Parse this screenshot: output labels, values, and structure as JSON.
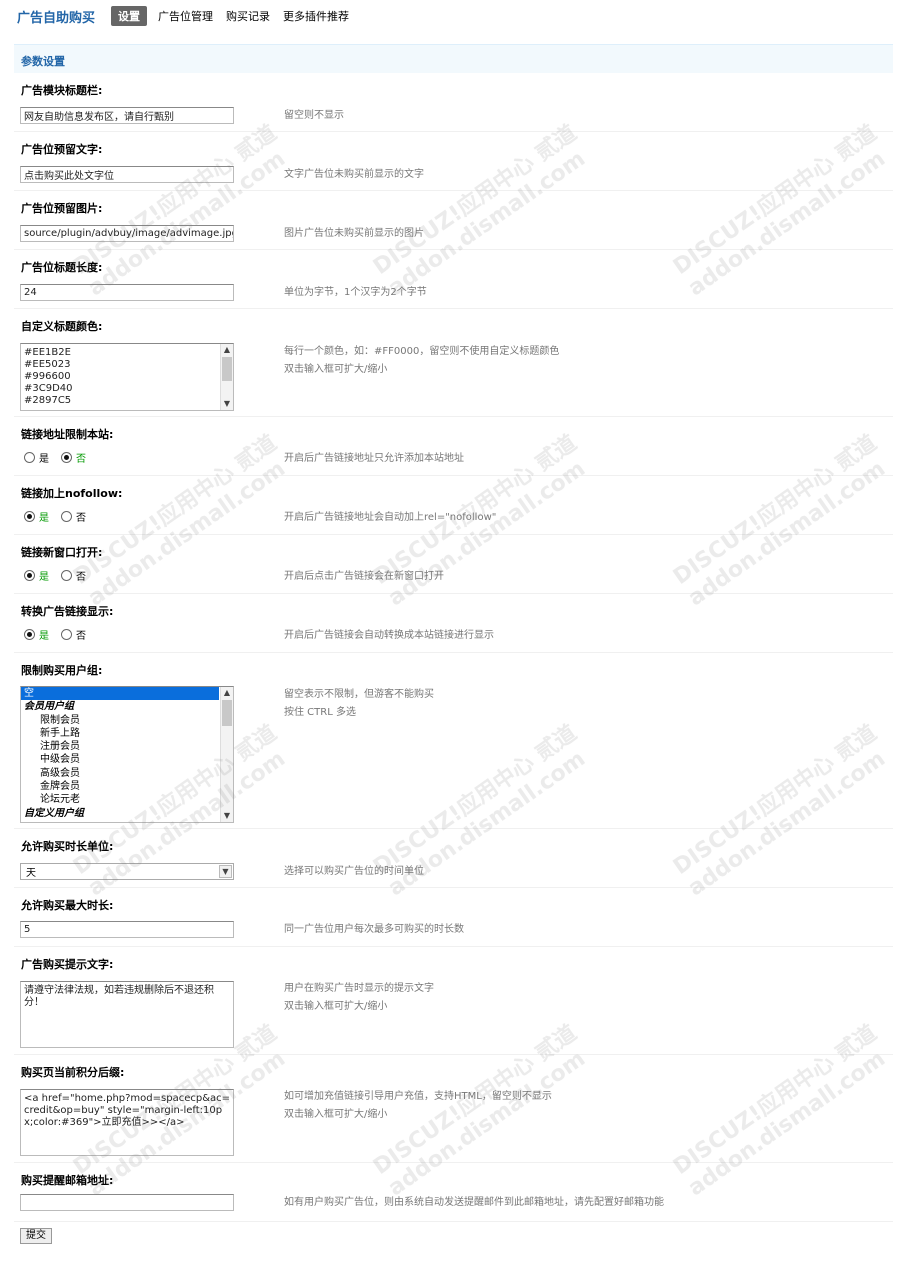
{
  "header": {
    "app_title": "广告自助购买",
    "tabs": [
      {
        "label": "设置",
        "active": true
      },
      {
        "label": "广告位管理",
        "active": false
      },
      {
        "label": "购买记录",
        "active": false
      },
      {
        "label": "更多插件推荐",
        "active": false
      }
    ]
  },
  "section": {
    "title": "参数设置"
  },
  "fields": {
    "module_title": {
      "label": "广告模块标题栏:",
      "value": "网友自助信息发布区，请自行甄别",
      "tip": "留空则不显示"
    },
    "reserved_text": {
      "label": "广告位预留文字:",
      "value": "点击购买此处文字位",
      "tip": "文字广告位未购买前显示的文字"
    },
    "reserved_image": {
      "label": "广告位预留图片:",
      "value": "source/plugin/advbuy/image/advimage.jpg",
      "tip": "图片广告位未购买前显示的图片"
    },
    "title_length": {
      "label": "广告位标题长度:",
      "value": "24",
      "tip": "单位为字节，1个汉字为2个字节"
    },
    "title_colors": {
      "label": "自定义标题颜色:",
      "lines": [
        "#EE1B2E",
        "#EE5023",
        "#996600",
        "#3C9D40",
        "#2897C5"
      ],
      "tip1": "每行一个颜色，如：#FF0000，留空则不使用自定义标题颜色",
      "tip2": "双击输入框可扩大/缩小"
    },
    "link_local": {
      "label": "链接地址限制本站:",
      "yes": "是",
      "no": "否",
      "selected": "no",
      "tip": "开启后广告链接地址只允许添加本站地址"
    },
    "nofollow": {
      "label": "链接加上nofollow:",
      "yes": "是",
      "no": "否",
      "selected": "yes",
      "tip": "开启后广告链接地址会自动加上rel=\"nofollow\""
    },
    "new_window": {
      "label": "链接新窗口打开:",
      "yes": "是",
      "no": "否",
      "selected": "yes",
      "tip": "开启后点击广告链接会在新窗口打开"
    },
    "convert_link": {
      "label": "转换广告链接显示:",
      "yes": "是",
      "no": "否",
      "selected": "yes",
      "tip": "开启后广告链接会自动转换成本站链接进行显示"
    },
    "user_groups": {
      "label": "限制购买用户组:",
      "options": [
        {
          "text": "空",
          "type": "selected"
        },
        {
          "text": "会员用户组",
          "type": "group"
        },
        {
          "text": "限制会员",
          "type": "child"
        },
        {
          "text": "新手上路",
          "type": "child"
        },
        {
          "text": "注册会员",
          "type": "child"
        },
        {
          "text": "中级会员",
          "type": "child"
        },
        {
          "text": "高级会员",
          "type": "child"
        },
        {
          "text": "金牌会员",
          "type": "child"
        },
        {
          "text": "论坛元老",
          "type": "child"
        },
        {
          "text": "自定义用户组",
          "type": "group"
        }
      ],
      "tip1": "留空表示不限制，但游客不能购买",
      "tip2": "按住 CTRL 多选"
    },
    "time_unit": {
      "label": "允许购买时长单位:",
      "value": "天",
      "tip": "选择可以购买广告位的时间单位"
    },
    "max_duration": {
      "label": "允许购买最大时长:",
      "value": "5",
      "tip": "同一广告位用户每次最多可购买的时长数"
    },
    "notice_text": {
      "label": "广告购买提示文字:",
      "value": "请遵守法律法规，如若违规删除后不退还积分！",
      "tip1": "用户在购买广告时显示的提示文字",
      "tip2": "双击输入框可扩大/缩小"
    },
    "credit_suffix": {
      "label": "购买页当前积分后缀:",
      "value": "<a href=\"home.php?mod=spacecp&ac=credit&op=buy\" style=\"margin-left:10px;color:#369\">立即充值>></a>",
      "tip1": "如可增加充值链接引导用户充值，支持HTML，留空则不显示",
      "tip2": "双击输入框可扩大/缩小"
    },
    "notify_email": {
      "label": "购买提醒邮箱地址:",
      "value": "",
      "tip": "如有用户购买广告位，则由系统自动发送提醒邮件到此邮箱地址，请先配置好邮箱功能"
    }
  },
  "submit_label": "提交",
  "watermark": {
    "brand": "DISCUZ!应用中心",
    "domain": "addon.dismall.com",
    "suffix": "贰道"
  }
}
